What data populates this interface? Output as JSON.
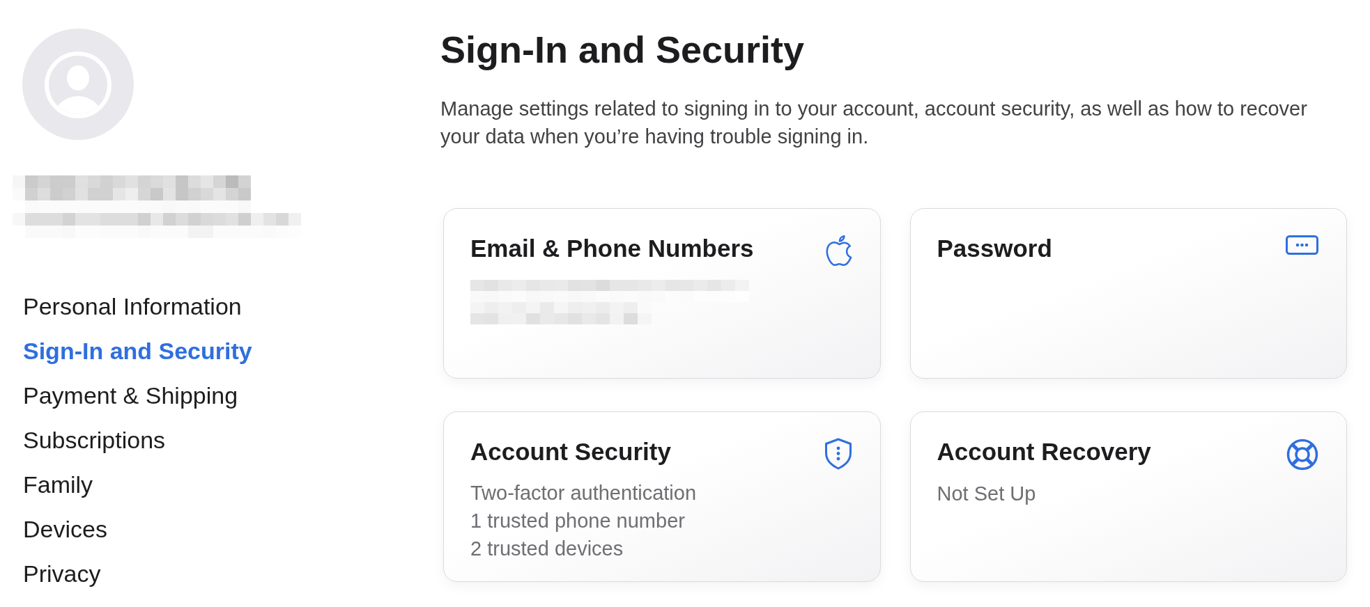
{
  "sidebar": {
    "items": [
      {
        "label": "Personal Information",
        "selected": false
      },
      {
        "label": "Sign-In and Security",
        "selected": true
      },
      {
        "label": "Payment & Shipping",
        "selected": false
      },
      {
        "label": "Subscriptions",
        "selected": false
      },
      {
        "label": "Family",
        "selected": false
      },
      {
        "label": "Devices",
        "selected": false
      },
      {
        "label": "Privacy",
        "selected": false
      }
    ]
  },
  "main": {
    "title": "Sign-In and Security",
    "description": "Manage settings related to signing in to your account, account security, as well as how to recover your data when you’re having trouble signing in.",
    "cards": [
      {
        "kind": "email",
        "title": "Email & Phone Numbers",
        "redacted": true
      },
      {
        "kind": "password",
        "title": "Password",
        "redacted": false
      },
      {
        "kind": "security",
        "title": "Account Security",
        "redacted": false,
        "lines": [
          "Two-factor authentication",
          "1 trusted phone number",
          "2 trusted devices"
        ]
      },
      {
        "kind": "recovery",
        "title": "Account Recovery",
        "redacted": false,
        "lines": [
          "Not Set Up"
        ]
      }
    ]
  }
}
